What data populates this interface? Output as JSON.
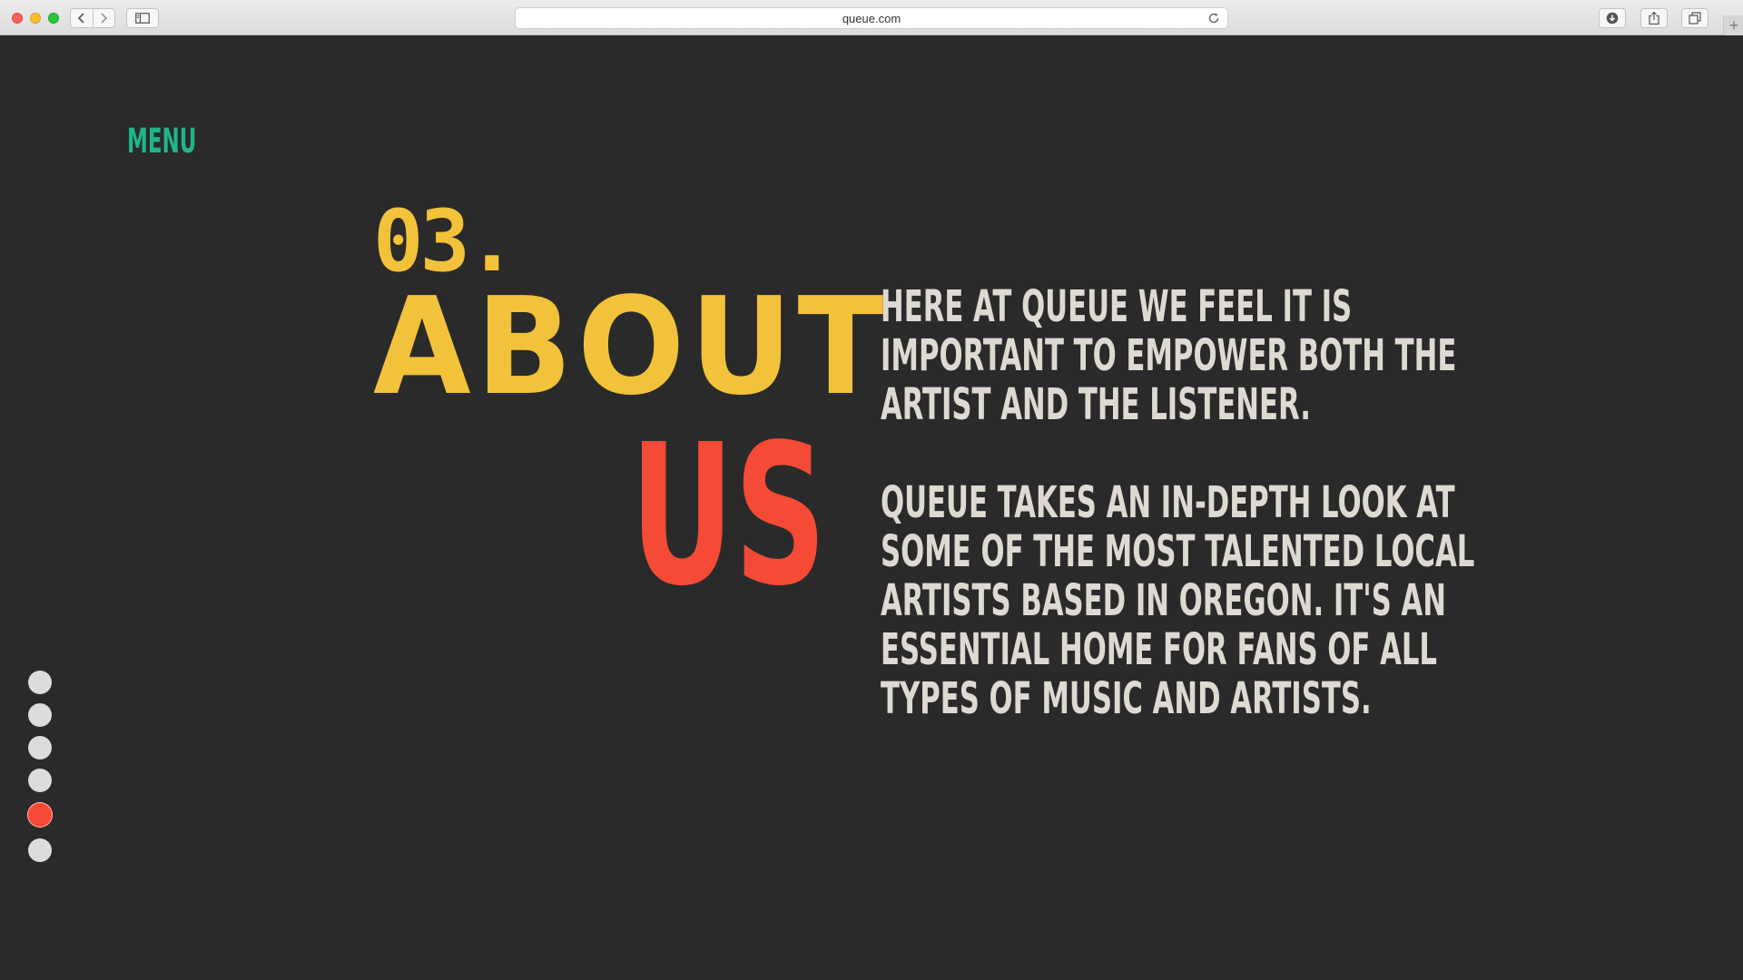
{
  "browser": {
    "url": "queue.com"
  },
  "page": {
    "menu_label": "MENU",
    "section_number": "03.",
    "title_line1": "ABOUT",
    "title_line2": "US",
    "paragraph1": [
      "HERE AT QUEUE WE FEEL IT IS",
      "IMPORTANT TO EMPOWER BOTH THE",
      "ARTIST AND THE LISTENER."
    ],
    "paragraph2": [
      "QUEUE TAKES AN IN-DEPTH LOOK AT",
      "SOME OF THE MOST TALENTED LOCAL",
      "ARTISTS BASED IN OREGON. IT'S AN",
      "ESSENTIAL HOME FOR FANS OF ALL",
      "TYPES OF MUSIC AND ARTISTS."
    ]
  },
  "dot_nav": {
    "count": 6,
    "active_index": 4
  },
  "colors": {
    "background": "#2a2a2a",
    "menu": "#1fb58a",
    "accent_yellow": "#f2c23a",
    "accent_red": "#f44a36",
    "body_text": "#dedad2",
    "dot_inactive": "#dcdcdc"
  }
}
